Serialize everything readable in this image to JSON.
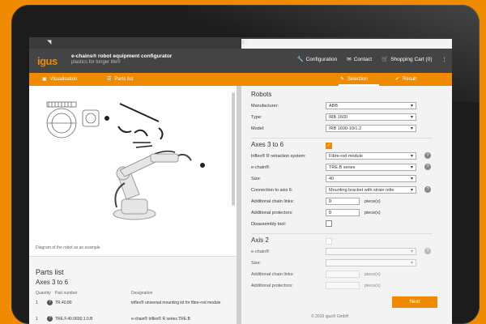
{
  "header": {
    "logo": "igus",
    "title": "e-chains® robot equipment configurator",
    "subtitle": "plastics for longer life®",
    "nav": [
      {
        "icon": "wrench-icon",
        "label": "Configuration"
      },
      {
        "icon": "mail-icon",
        "label": "Contact"
      },
      {
        "icon": "cart-icon",
        "label": "Shopping Cart (0)"
      }
    ]
  },
  "tabs": {
    "left": [
      {
        "icon": "image-icon",
        "label": "Visualisation"
      },
      {
        "icon": "list-icon",
        "label": "Parts list"
      }
    ],
    "right": [
      {
        "icon": "pencil-icon",
        "label": "Selection"
      },
      {
        "icon": "check-icon",
        "label": "Result"
      }
    ]
  },
  "visualisation": {
    "caption": "Diagram of the robot as an example"
  },
  "parts": {
    "title": "Parts list",
    "section": "Axes 3 to 6",
    "columns": [
      "Quantity",
      "Part number",
      "Designation"
    ],
    "rows": [
      {
        "qty": "1",
        "part": "TR.40.80",
        "designation": "triflex® universal mounting kit for fibre-rod module"
      },
      {
        "qty": "1",
        "part": "TRE.F.40.0600.1.0.B",
        "designation": "e-chain® triflex® R series TRE.B"
      }
    ]
  },
  "robots": {
    "title": "Robots",
    "manufacturer": {
      "label": "Manufacturer:",
      "value": "ABB"
    },
    "type": {
      "label": "Type:",
      "value": "IRB 1600"
    },
    "model": {
      "label": "Model:",
      "value": "IRB 1600-10/1.2"
    }
  },
  "axes36": {
    "title": "Axes 3 to 6",
    "retraction": {
      "label": "triflex® R retraction system:",
      "value": "Fibre-rod module"
    },
    "echain": {
      "label": "e-chain®:",
      "value": "TRE.B series"
    },
    "size": {
      "label": "Size:",
      "value": "40"
    },
    "connection": {
      "label": "Connection to axis 6:",
      "value": "Mounting bracket with strain relie"
    },
    "links": {
      "label": "Additional chain links:",
      "value": "0",
      "unit": "piece(s)"
    },
    "protectors": {
      "label": "Additional protectors:",
      "value": "0",
      "unit": "piece(s)"
    },
    "disassembly": {
      "label": "Disassembly tool:"
    }
  },
  "axis2": {
    "title": "Axis 2",
    "echain": {
      "label": "e-chain®:"
    },
    "size": {
      "label": "Size:"
    },
    "links": {
      "label": "Additional chain links:",
      "unit": "piece(s)"
    },
    "protectors": {
      "label": "Additional protectors:",
      "unit": "piece(s)"
    }
  },
  "footer": {
    "next": "Next",
    "copyright": "© 2019 igus® GmbH"
  },
  "colors": {
    "accent": "#f08a00",
    "header": "#444444",
    "panel": "#f3f3f3"
  }
}
